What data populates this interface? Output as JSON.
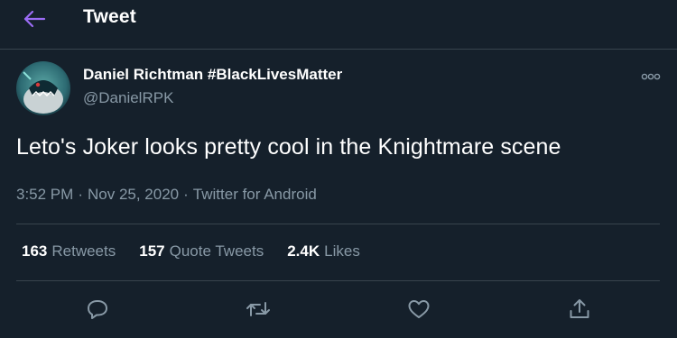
{
  "header": {
    "title": "Tweet",
    "back_icon": "arrow-left-icon"
  },
  "colors": {
    "background": "#15202b",
    "accent": "#9b6cf5",
    "secondary_text": "#8899a6",
    "divider": "#38444d",
    "icon": "#8899a6"
  },
  "tweet": {
    "author_name": "Daniel Richtman #BlackLivesMatter",
    "author_handle": "@DanielRPK",
    "text": "Leto's Joker looks pretty cool in the Knightmare scene",
    "time": "3:52 PM",
    "date": "Nov 25, 2020",
    "source": "Twitter for Android",
    "separator": "·"
  },
  "stats": {
    "retweets_count": "163",
    "retweets_label": "Retweets",
    "quotes_count": "157",
    "quotes_label": "Quote Tweets",
    "likes_count": "2.4K",
    "likes_label": "Likes"
  },
  "actions": [
    "reply-icon",
    "retweet-icon",
    "like-icon",
    "share-icon"
  ]
}
